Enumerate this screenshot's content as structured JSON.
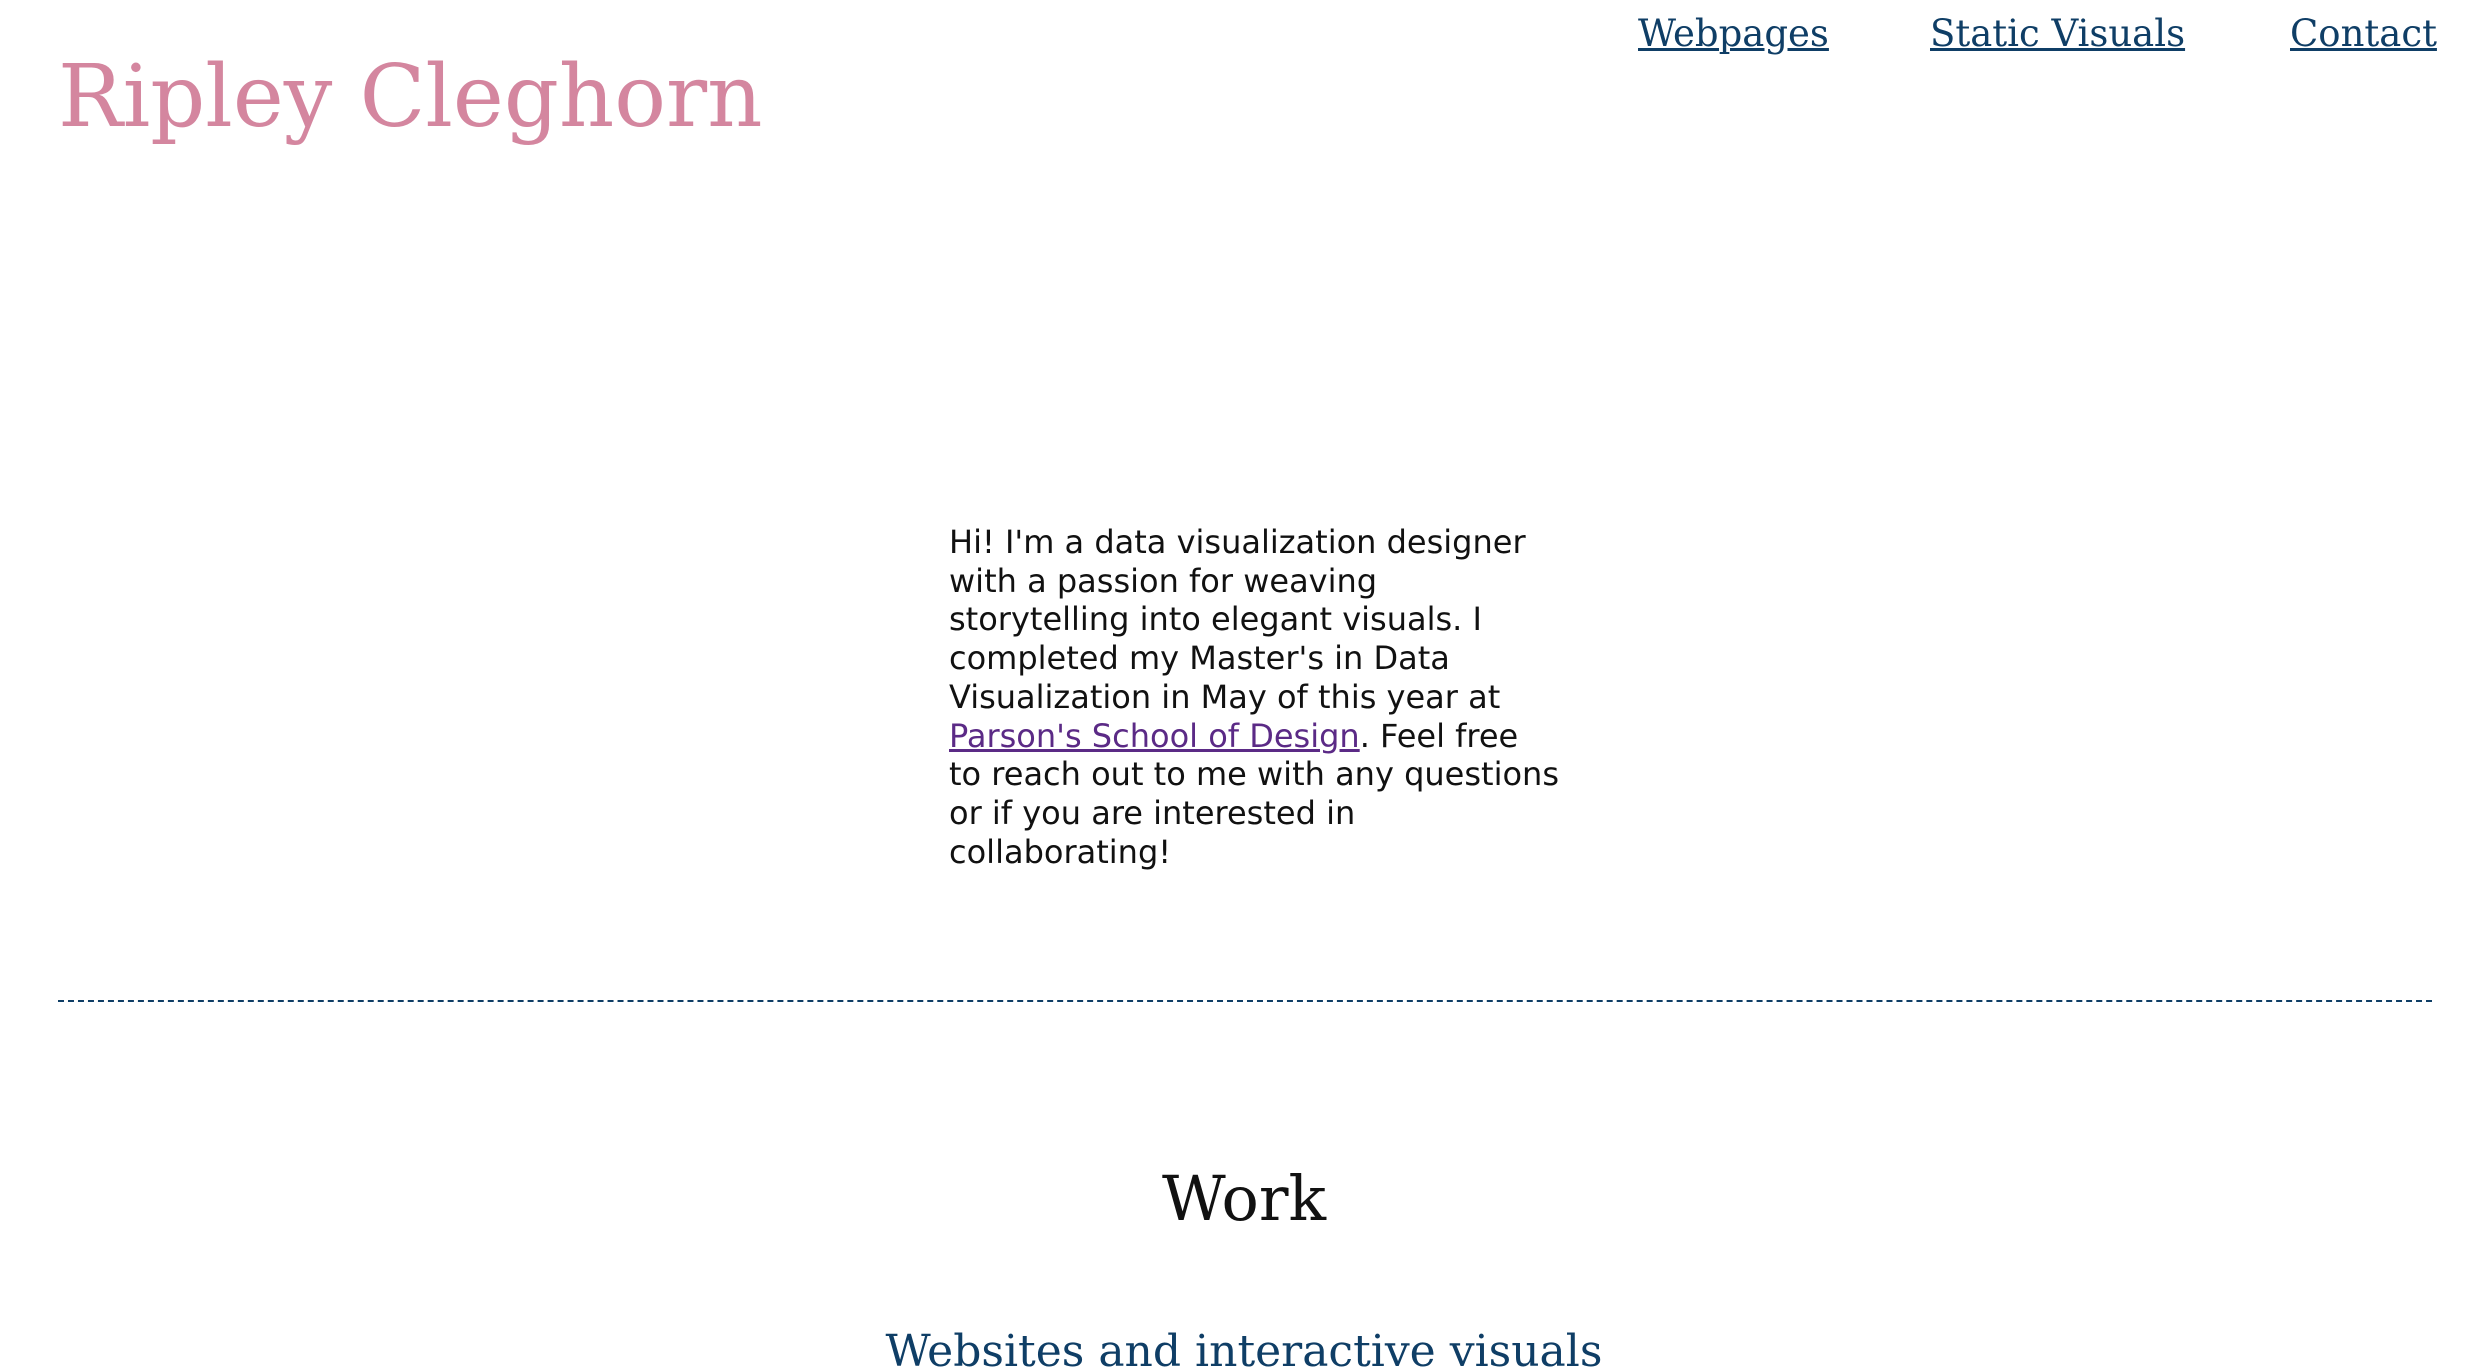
{
  "header": {
    "site_title": "Ripley Cleghorn"
  },
  "nav": {
    "items": [
      {
        "label": "Webpages"
      },
      {
        "label": "Static Visuals"
      },
      {
        "label": "Contact"
      }
    ]
  },
  "intro": {
    "text_before_link": "Hi! I'm a data visualization designer with a passion for weaving storytelling into elegant visuals. I completed my Master's in Data Visualization in May of this year at ",
    "link_text": "Parson's School of Design",
    "text_after_link": ". Feel free to reach out to me with any questions or if you are interested in collaborating!"
  },
  "work": {
    "heading": "Work",
    "subheading": "Websites and interactive visuals"
  },
  "colors": {
    "title_pink": "#d4869f",
    "nav_blue": "#0f3e66",
    "link_purple": "#5b2a86",
    "body_text": "#111111",
    "background": "#ffffff"
  }
}
